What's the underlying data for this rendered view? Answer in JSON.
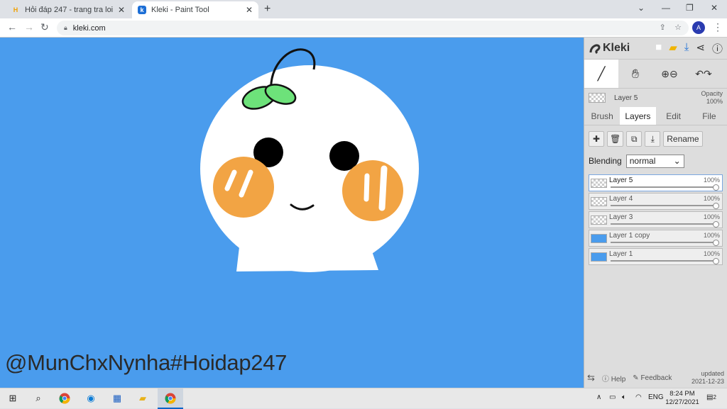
{
  "browser": {
    "tabs": [
      {
        "title": "Hỏi đáp 247 - trang tra loi",
        "favicon": "hoidap-favicon-icon"
      },
      {
        "title": "Kleki - Paint Tool",
        "favicon": "kleki-favicon-icon"
      }
    ],
    "url": "kleki.com",
    "profile_initial": "A"
  },
  "canvas": {
    "background": "#4a9ced",
    "signature": "@MunChxNynha#Hoidap247"
  },
  "panel": {
    "logo": "Kleki",
    "current_layer": {
      "name": "Layer 5",
      "opacity_label": "Opacity",
      "opacity_value": "100%"
    },
    "tabs": [
      "Brush",
      "Layers",
      "Edit",
      "File"
    ],
    "active_tab": "Layers",
    "actions": {
      "rename": "Rename"
    },
    "blending": {
      "label": "Blending",
      "value": "normal"
    },
    "layers": [
      {
        "name": "Layer 5",
        "opacity": "100%",
        "selected": true,
        "filled": false
      },
      {
        "name": "Layer 4",
        "opacity": "100%",
        "selected": false,
        "filled": false
      },
      {
        "name": "Layer 3",
        "opacity": "100%",
        "selected": false,
        "filled": false
      },
      {
        "name": "Layer 1 copy",
        "opacity": "100%",
        "selected": false,
        "filled": true
      },
      {
        "name": "Layer 1",
        "opacity": "100%",
        "selected": false,
        "filled": true
      }
    ],
    "footer": {
      "help": "Help",
      "feedback": "Feedback",
      "updated_label": "updated",
      "updated_date": "2021-12-23"
    }
  },
  "taskbar": {
    "language": "ENG",
    "time": "8:24 PM",
    "date": "12/27/2021",
    "notification_count": "2"
  }
}
